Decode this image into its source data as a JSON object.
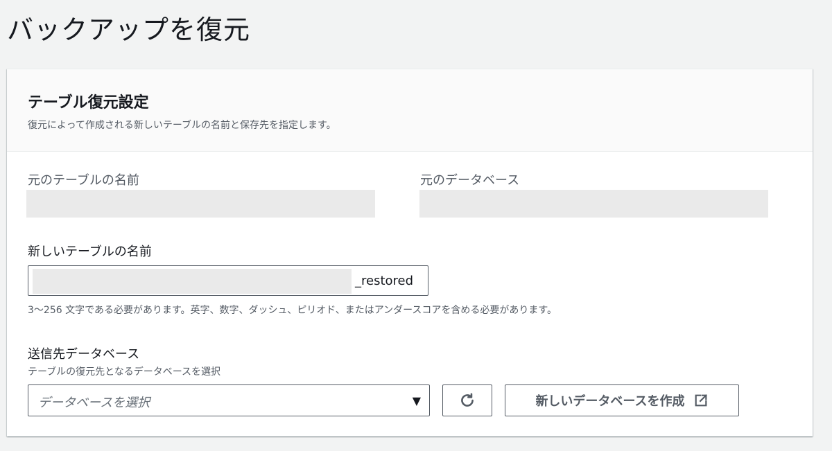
{
  "page": {
    "title": "バックアップを復元"
  },
  "section": {
    "title": "テーブル復元設定",
    "description": "復元によって作成される新しいテーブルの名前と保存先を指定します。"
  },
  "source_table": {
    "label": "元のテーブルの名前",
    "value": ""
  },
  "source_database": {
    "label": "元のデータベース",
    "value": ""
  },
  "new_table": {
    "label": "新しいテーブルの名前",
    "value": "",
    "suffix": "_restored",
    "constraint": "3〜256 文字である必要があります。英字、数字、ダッシュ、ピリオド、またはアンダースコアを含める必要があります。"
  },
  "destination_db": {
    "label": "送信先データベース",
    "description": "テーブルの復元先となるデータベースを選択",
    "placeholder": "データベースを選択",
    "caret_icon": "caret-down-icon"
  },
  "buttons": {
    "refresh_icon": "refresh-icon",
    "create_label": "新しいデータベースを作成",
    "external_icon": "external-link-icon"
  }
}
